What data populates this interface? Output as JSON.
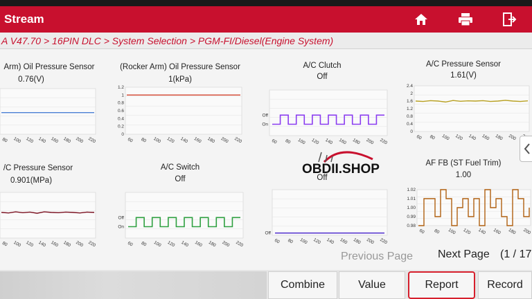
{
  "header": {
    "title": "Stream",
    "icons": [
      "home-icon",
      "print-icon",
      "exit-icon"
    ]
  },
  "breadcrumb": "A V47.70 > 16PIN DLC > System Selection > PGM-FI/Diesel(Engine System)",
  "panels": [
    {
      "id": "p1",
      "title": "Arm) Oil Pressure Sensor",
      "value": "0.76(V)"
    },
    {
      "id": "p2",
      "title": "(Rocker Arm) Oil Pressure Sensor",
      "value": "1(kPa)"
    },
    {
      "id": "p3",
      "title": "A/C Clutch",
      "value": "Off"
    },
    {
      "id": "p4",
      "title": "A/C Pressure Sensor",
      "value": "1.61(V)"
    },
    {
      "id": "p5",
      "title": "/C Pressure Sensor",
      "value": "0.901(MPa)"
    },
    {
      "id": "p6",
      "title": "A/C Switch",
      "value": "Off"
    },
    {
      "id": "p7",
      "title": "",
      "value": "Off"
    },
    {
      "id": "p8",
      "title": "AF FB (ST Fuel Trim)",
      "value": "1.00"
    }
  ],
  "chart_data": [
    {
      "type": "line",
      "panel": "p1",
      "title": "Arm) Oil Pressure Sensor",
      "x_ticks": [
        "80",
        "100",
        "120",
        "140",
        "160",
        "180",
        "200",
        "220"
      ],
      "series": [
        {
          "color": "#4a7fd4",
          "values": [
            0.76,
            0.76,
            0.76,
            0.76,
            0.76,
            0.76,
            0.76,
            0.76
          ]
        }
      ]
    },
    {
      "type": "line",
      "panel": "p2",
      "title": "(Rocker Arm) Oil Pressure Sensor",
      "y_ticks": [
        "1.2",
        "1",
        "0.8",
        "0.6",
        "0.4",
        "0.2",
        "0"
      ],
      "ylim": [
        0,
        1.2
      ],
      "x_ticks": [
        "60",
        "80",
        "100",
        "120",
        "140",
        "160",
        "180",
        "200",
        "220"
      ],
      "series": [
        {
          "color": "#d0402a",
          "values": [
            1,
            1,
            1,
            1,
            1,
            1,
            1,
            1,
            1
          ]
        }
      ]
    },
    {
      "type": "line",
      "panel": "p3",
      "title": "A/C Clutch",
      "y_ticks": [
        "Off",
        "On"
      ],
      "x_ticks": [
        "60",
        "80",
        "100",
        "120",
        "140",
        "160",
        "180",
        "200",
        "220"
      ],
      "series": [
        {
          "color": "#8a3cf0",
          "values": [
            "On",
            "Off",
            "On",
            "Off",
            "On",
            "Off",
            "On",
            "Off",
            "On",
            "Off",
            "On",
            "Off",
            "On",
            "Off"
          ]
        }
      ]
    },
    {
      "type": "line",
      "panel": "p4",
      "title": "A/C Pressure Sensor",
      "y_ticks": [
        "2.4",
        "2",
        "1.6",
        "1.2",
        "0.8",
        "0.4",
        "0"
      ],
      "ylim": [
        0,
        2.4
      ],
      "x_ticks": [
        "60",
        "80",
        "100",
        "120",
        "140",
        "160",
        "180",
        "200",
        "220"
      ],
      "series": [
        {
          "color": "#b8a020",
          "values": [
            1.6,
            1.58,
            1.62,
            1.6,
            1.55,
            1.63,
            1.59,
            1.61,
            1.6,
            1.62,
            1.58,
            1.6,
            1.64,
            1.6,
            1.58,
            1.61
          ]
        }
      ]
    },
    {
      "type": "line",
      "panel": "p5",
      "title": "/C Pressure Sensor",
      "x_ticks": [
        "80",
        "100",
        "120",
        "140",
        "160",
        "180",
        "200",
        "220"
      ],
      "series": [
        {
          "color": "#7a1020",
          "values": [
            0.9,
            0.88,
            0.92,
            0.89,
            0.91,
            0.87,
            0.92,
            0.9,
            0.89,
            0.91,
            0.9,
            0.88,
            0.91,
            0.9
          ]
        }
      ]
    },
    {
      "type": "line",
      "panel": "p6",
      "title": "A/C Switch",
      "y_ticks": [
        "Off",
        "On"
      ],
      "x_ticks": [
        "60",
        "80",
        "100",
        "120",
        "140",
        "160",
        "180",
        "200",
        "220"
      ],
      "series": [
        {
          "color": "#2ea040",
          "values": [
            "On",
            "Off",
            "On",
            "Off",
            "On",
            "Off",
            "On",
            "Off",
            "On",
            "Off",
            "On",
            "Off",
            "On",
            "Off"
          ]
        }
      ]
    },
    {
      "type": "line",
      "panel": "p7",
      "title": "",
      "y_ticks": [
        "Off"
      ],
      "x_ticks": [
        "60",
        "80",
        "100",
        "120",
        "140",
        "160",
        "180",
        "200",
        "220"
      ],
      "series": [
        {
          "color": "#5a3ad0",
          "values": [
            "Off",
            "Off",
            "Off",
            "Off",
            "Off",
            "Off",
            "Off",
            "Off",
            "Off"
          ]
        }
      ]
    },
    {
      "type": "line",
      "panel": "p8",
      "title": "AF FB (ST Fuel Trim)",
      "y_ticks": [
        "1.02",
        "1.01",
        "1.00",
        "0.99",
        "0.98"
      ],
      "ylim": [
        0.98,
        1.02
      ],
      "x_ticks": [
        "60",
        "80",
        "100",
        "120",
        "140",
        "160",
        "180",
        "200"
      ],
      "series": [
        {
          "color": "#b06010",
          "values": [
            0.98,
            1.01,
            1.01,
            0.99,
            1.02,
            1.01,
            0.98,
            1.0,
            1.01,
            0.99,
            1.01,
            0.98,
            1.02,
            1.0,
            1.01,
            0.99,
            0.98,
            1.02,
            1.01,
            0.99,
            1.0
          ]
        }
      ]
    }
  ],
  "pagination": {
    "previous": "Previous Page",
    "next": "Next Page",
    "counter": "(1 / 17"
  },
  "buttons": {
    "combine": "Combine",
    "value": "Value",
    "report": "Report",
    "record": "Record"
  },
  "watermark": "OBDII.SHOP",
  "colors": {
    "brand_red": "#c8102e"
  }
}
